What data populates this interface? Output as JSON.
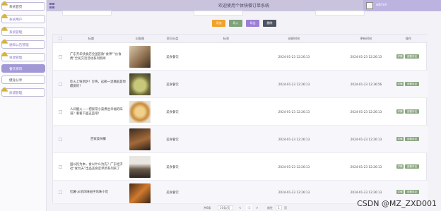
{
  "header": {
    "title": "欢迎使用个体快餐订单系统",
    "username": "admin"
  },
  "sidebar": {
    "items": [
      {
        "label": "系统首页"
      },
      {
        "label": "系统用户"
      },
      {
        "label": "系统管理"
      },
      {
        "label": "通知公告管理"
      },
      {
        "label": "资源管理"
      },
      {
        "label": "餐饮资讯"
      },
      {
        "label": "健身分享"
      },
      {
        "label": "商城管理"
      }
    ]
  },
  "toolbar": {
    "add_label": "添加",
    "import_label": "导入",
    "export_label": "导出",
    "delete_label": "删除"
  },
  "table": {
    "headers": [
      "标题",
      "封面图",
      "资讯分类",
      "标签",
      "创建时间",
      "更新时间",
      "操作"
    ],
    "rows": [
      {
        "title": "广东芳华快食店全国首款“食神”“伙食费”全民交流活动系列新闻",
        "category": "美食餐饮",
        "created": "2024-01-23 12:26:13",
        "updated": "2024-01-23 12:26:13",
        "thumb_color": "#8a6b4b"
      },
      {
        "title": "吃火上快到炉！叮咚，这碗一盅桶就是你最爱的！",
        "category": "美食餐饮",
        "created": "2024-01-23 12:26:13",
        "updated": "2024-01-23 12:36:56",
        "thumb_color": "#a9b06a"
      },
      {
        "title": "人间烟火——把家常小菜煮出幸福的味道？看看下面这些吧！",
        "category": "美食餐饮",
        "created": "2024-01-23 12:26:13",
        "updated": "2024-01-23 12:26:13",
        "thumb_color": "#d9b064"
      },
      {
        "title": "百家美味餐",
        "category": "美食餐饮",
        "created": "2024-01-23 12:26:13",
        "updated": "2024-01-23 12:26:13",
        "thumb_color": "#7a4a2c"
      },
      {
        "title": "国以民为本，食以什么为先？广东经济社“食为天”出品美食菜单新系列来了",
        "category": "美食餐饮",
        "created": "2024-01-23 12:26:13",
        "updated": "2024-01-23 12:26:13",
        "thumb_color": "#5a4a3a"
      },
      {
        "title": "红薯·从前风味园子风味小吃",
        "category": "美食餐饮",
        "created": "2024-01-23 12:26:13",
        "updated": "2024-01-23 12:26:13",
        "thumb_color": "#c2712f"
      }
    ],
    "action_detail": "详情",
    "action_edit": "查看评论"
  },
  "pager": {
    "total": "共6条",
    "per_page": "10条/页",
    "prev": "<",
    "page": "1",
    "next": ">",
    "goto_label": "前往",
    "goto_page": "1",
    "goto_unit": "页"
  },
  "watermark": "CSDN @MZ_ZXD001"
}
